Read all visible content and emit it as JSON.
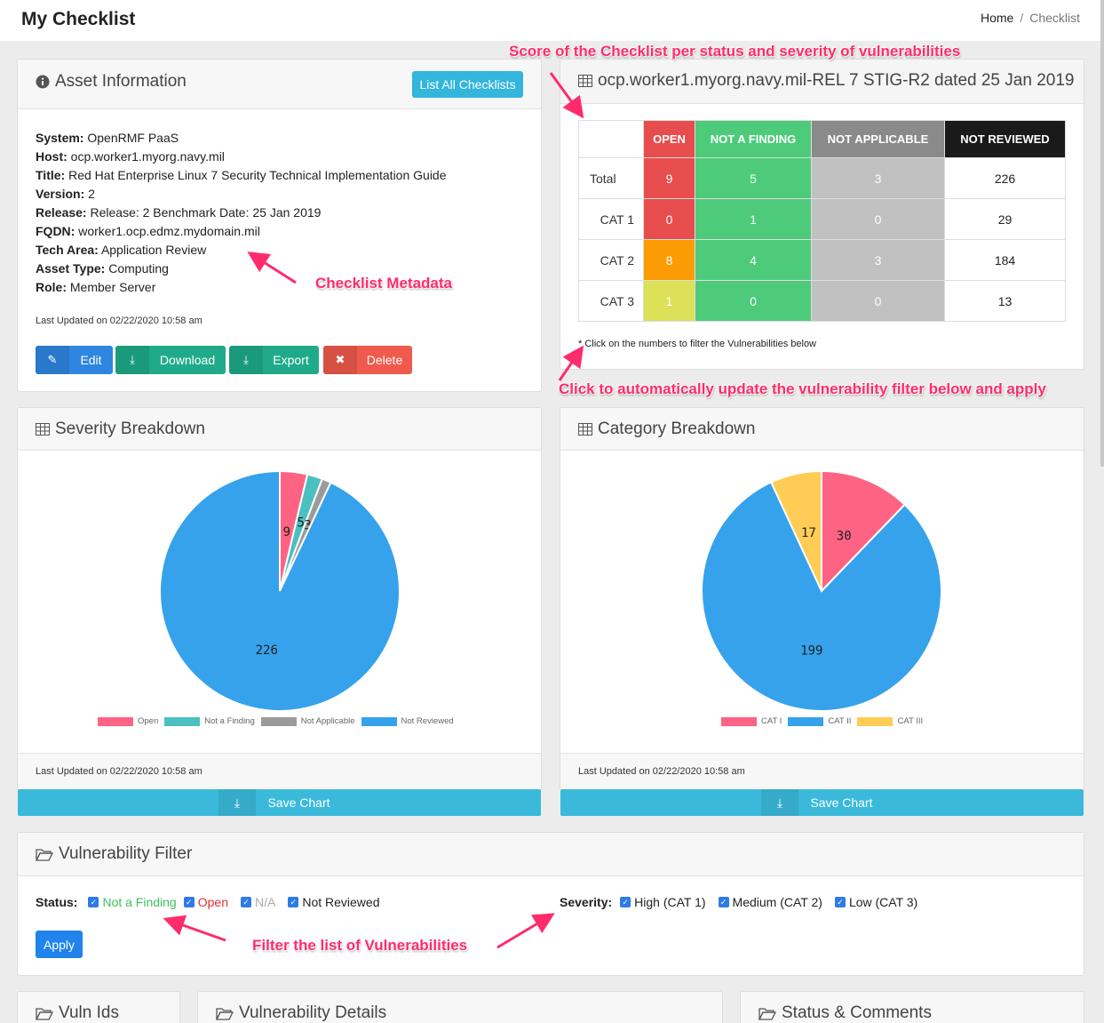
{
  "header": {
    "title": "My Checklist",
    "breadcrumb": [
      {
        "label": "Home"
      },
      {
        "label": "Checklist"
      }
    ],
    "breadcrumb_sep": "/"
  },
  "asset_panel": {
    "title": "Asset Information",
    "list_all_label": "List All Checklists",
    "fields": [
      {
        "label": "System:",
        "value": "OpenRMF PaaS"
      },
      {
        "label": "Host:",
        "value": "ocp.worker1.myorg.navy.mil"
      },
      {
        "label": "Title:",
        "value": "Red Hat Enterprise Linux 7 Security Technical Implementation Guide"
      },
      {
        "label": "Version:",
        "value": "2"
      },
      {
        "label": "Release:",
        "value": "Release: 2 Benchmark Date: 25 Jan 2019"
      },
      {
        "label": "FQDN:",
        "value": "worker1.ocp.edmz.mydomain.mil"
      },
      {
        "label": "Tech Area:",
        "value": "Application Review"
      },
      {
        "label": "Asset Type:",
        "value": "Computing"
      },
      {
        "label": "Role:",
        "value": "Member Server"
      }
    ],
    "last_updated": "Last Updated on 02/22/2020 10:58 am",
    "actions": {
      "edit": "Edit",
      "download": "Download",
      "export": "Export",
      "delete": "Delete"
    }
  },
  "score_panel": {
    "title": "ocp.worker1.myorg.navy.mil-REL 7 STIG-R2 dated 25 Jan 2019",
    "headers": [
      "OPEN",
      "NOT A FINDING",
      "NOT APPLICABLE",
      "NOT REVIEWED"
    ],
    "rows": [
      {
        "label": "Total",
        "values": [
          "9",
          "5",
          "3",
          "226"
        ]
      },
      {
        "label": "CAT 1",
        "values": [
          "0",
          "1",
          "0",
          "29"
        ]
      },
      {
        "label": "CAT 2",
        "values": [
          "8",
          "4",
          "3",
          "184"
        ]
      },
      {
        "label": "CAT 3",
        "values": [
          "1",
          "0",
          "0",
          "13"
        ]
      }
    ],
    "footnote": "* Click on the numbers to filter the Vulnerabilities below"
  },
  "severity_panel": {
    "title": "Severity Breakdown",
    "last_updated": "Last Updated on 02/22/2020 10:58 am",
    "save_label": "Save Chart"
  },
  "category_panel": {
    "title": "Category Breakdown",
    "last_updated": "Last Updated on 02/22/2020 10:58 am",
    "save_label": "Save Chart"
  },
  "chart_data": [
    {
      "type": "pie",
      "labels": [
        "Open",
        "Not a Finding",
        "Not Applicable",
        "Not Reviewed"
      ],
      "values": [
        9,
        5,
        3,
        226
      ],
      "colors": [
        "#ff6384",
        "#4bc0c0",
        "#9b9b9b",
        "#36a2eb"
      ],
      "legend": "bottom"
    },
    {
      "type": "pie",
      "labels": [
        "CAT I",
        "CAT II",
        "CAT III"
      ],
      "values": [
        30,
        199,
        17
      ],
      "colors": [
        "#ff6384",
        "#36a2eb",
        "#ffcd56"
      ],
      "legend": "bottom"
    }
  ],
  "filter_panel": {
    "title": "Vulnerability Filter",
    "status_label": "Status:",
    "status_options": [
      {
        "label": "Not a Finding",
        "color": "#3fbf5b"
      },
      {
        "label": "Open",
        "color": "#e02e2e"
      },
      {
        "label": "N/A",
        "color": "#aaaaaa"
      },
      {
        "label": "Not Reviewed",
        "color": "#222222"
      }
    ],
    "severity_label": "Severity:",
    "severity_options": [
      {
        "label": "High (CAT 1)"
      },
      {
        "label": "Medium (CAT 2)"
      },
      {
        "label": "Low (CAT 3)"
      }
    ],
    "apply_label": "Apply"
  },
  "bottom_panels": {
    "vuln_ids": "Vuln Ids",
    "vuln_details": "Vulnerability Details",
    "status_comments": "Status & Comments"
  },
  "annotations": {
    "score": "Score of the Checklist per status and severity of vulnerabilities",
    "metadata": "Checklist Metadata",
    "click": "Click to automatically update the vulnerability filter below and apply",
    "filter": "Filter the list of Vulnerabilities"
  },
  "colors": {
    "accent": "#33b5dc",
    "primary": "#2f7be6",
    "danger": "#ef5a4c",
    "success": "#1fab89",
    "annotation": "#ff2b6b"
  }
}
